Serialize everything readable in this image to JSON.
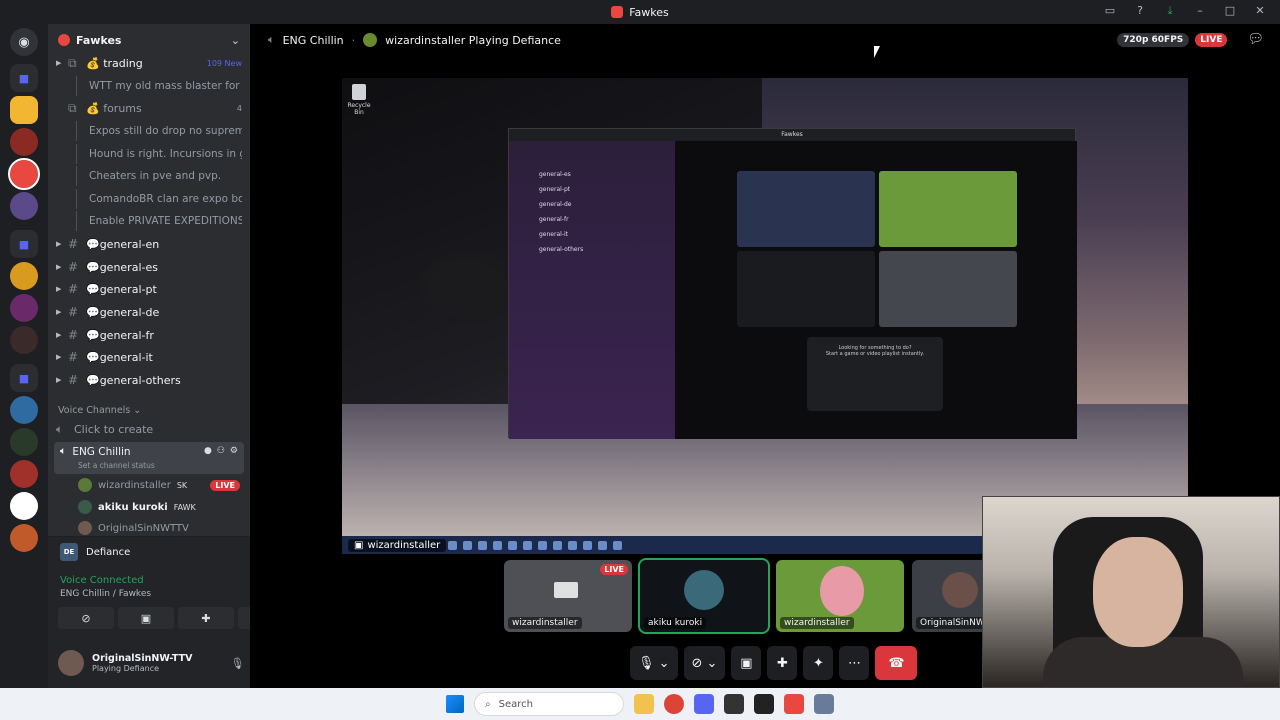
{
  "window": {
    "title": "Fawkes"
  },
  "colors": {
    "live": "#da373c",
    "connected": "#23a55a",
    "blurple": "#5865f2",
    "sidebar": "#2b2d31"
  },
  "server": {
    "name": "Fawkes",
    "channels": [
      {
        "name": "💰 trading",
        "badge": "109 New",
        "type": "forum"
      },
      {
        "name": "WTT my old mass blaster for som...",
        "type": "thread"
      },
      {
        "name": "💰 forums",
        "badge": "4",
        "type": "forum"
      },
      {
        "name": "Expos still do drop no supreme ch...",
        "type": "thread"
      },
      {
        "name": "Hound is right. Incursions in gene...",
        "type": "thread"
      },
      {
        "name": "Cheaters in pve and pvp.",
        "type": "thread"
      },
      {
        "name": "ComandoBR clan are expo booters",
        "type": "thread"
      },
      {
        "name": "Enable PRIVATE EXPEDITIONS - t...",
        "type": "thread"
      },
      {
        "name": "💬general-en",
        "type": "text"
      },
      {
        "name": "💬general-es",
        "type": "text"
      },
      {
        "name": "💬general-pt",
        "type": "text"
      },
      {
        "name": "💬general-de",
        "type": "text"
      },
      {
        "name": "💬general-fr",
        "type": "text"
      },
      {
        "name": "💬general-it",
        "type": "text"
      },
      {
        "name": "💬general-others",
        "type": "text"
      }
    ],
    "voice_section": "Voice Channels",
    "create_channel": "Click to create",
    "active_voice": {
      "name": "ENG Chillin",
      "status": "Set a channel status"
    },
    "voice_members": [
      {
        "name": "wizardinstaller",
        "tag": "SK",
        "live": "LIVE"
      },
      {
        "name": "akiku kuroki",
        "tag": "FAWK",
        "live": ""
      },
      {
        "name": "OriginalSinNWTTV",
        "tag": "",
        "live": ""
      }
    ]
  },
  "voice_panel": {
    "game": "Defiance",
    "game_logo": "DE",
    "status": "Voice Connected",
    "location": "ENG Chillin / Fawkes"
  },
  "user": {
    "name": "OriginalSinNW-TTV",
    "status": "Playing Defiance"
  },
  "stage": {
    "channel": "ENG Chillin",
    "activity": "wizardinstaller Playing Defiance",
    "quality": "720p 60FPS",
    "live": "LIVE",
    "streamer": "wizardinstaller",
    "recycle": "Recycle Bin",
    "inner_title": "Fawkes",
    "inner_channels": [
      "general-es",
      "general-pt",
      "general-de",
      "general-fr",
      "general-it",
      "general-others"
    ],
    "inner_popup": "Looking for something to do?",
    "inner_popup_sub": "Start a game or video playlist instantly."
  },
  "tiles": [
    {
      "name": "wizardinstaller",
      "live": "LIVE",
      "bg": "#4f5055"
    },
    {
      "name": "akiku kuroki",
      "live": "",
      "bg": "#101418"
    },
    {
      "name": "wizardinstaller",
      "live": "",
      "bg": "#6a9a3a"
    },
    {
      "name": "OriginalSinNWTTV",
      "live": "",
      "bg": "#3c3f45"
    }
  ],
  "taskbar": {
    "search": "Search"
  }
}
